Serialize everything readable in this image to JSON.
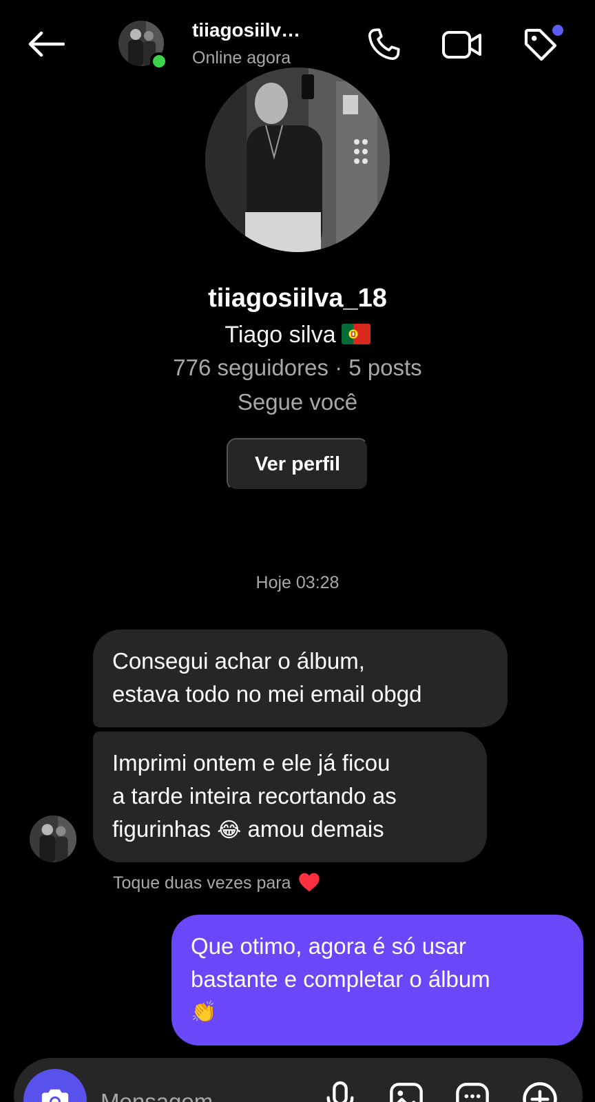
{
  "header": {
    "username": "tiiagosiilv…",
    "status": "Online agora",
    "has_notification_dot": true
  },
  "profile": {
    "username": "tiiagosiilva_18",
    "full_name": "Tiago silva",
    "flag": "portugal-flag",
    "stats": "776 seguidores · 5 posts",
    "follows_you": "Segue você",
    "view_profile_label": "Ver perfil"
  },
  "timestamp": "Hoje 03:28",
  "messages": [
    {
      "from": "them",
      "lines": [
        "Consegui achar o álbum,",
        "estava todo no mei email obgd"
      ]
    },
    {
      "from": "them",
      "lines": [
        "Imprimi ontem e ele já ficou",
        "a tarde inteira recortando as",
        "figurinhas"
      ],
      "emoji_inline": "😂",
      "line3_tail": " amou demais"
    },
    {
      "from": "me",
      "lines": [
        "Que otimo, agora é só usar",
        "bastante e completar o álbum",
        "👏"
      ]
    }
  ],
  "double_tap_hint": "Toque duas vezes para",
  "composer": {
    "placeholder": "Mensagem"
  },
  "colors": {
    "background": "#000000",
    "incoming_bubble": "#262626",
    "outgoing_bubble": "#6a47f8",
    "online": "#3cd24a",
    "camera_button": "#5851ec",
    "heart": "#ff3040"
  },
  "icons": [
    "arrow-left-icon",
    "phone-icon",
    "video-camera-icon",
    "tag-icon",
    "camera-icon",
    "microphone-icon",
    "image-icon",
    "sticker-icon",
    "plus-icon",
    "heart-icon"
  ]
}
